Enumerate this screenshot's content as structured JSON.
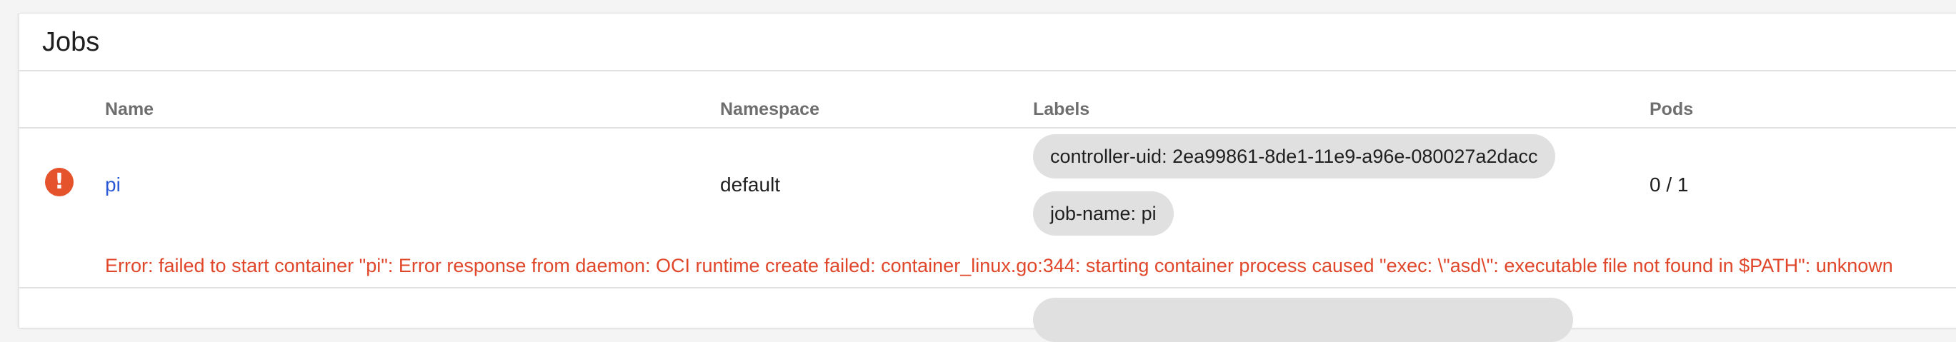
{
  "card": {
    "title": "Jobs"
  },
  "table": {
    "columns": {
      "name": "Name",
      "namespace": "Namespace",
      "labels": "Labels",
      "pods": "Pods"
    },
    "rows": [
      {
        "status": "error",
        "status_icon": "error-icon",
        "name": "pi",
        "namespace": "default",
        "labels": [
          "controller-uid: 2ea99861-8de1-11e9-a96e-080027a2dacc",
          "job-name: pi"
        ],
        "pods": "0 / 1",
        "error_message": "Error: failed to start container \"pi\": Error response from daemon: OCI runtime create failed: container_linux.go:344: starting container process caused \"exec: \\\"asd\\\": executable file not found in $PATH\": unknown"
      }
    ]
  },
  "colors": {
    "error": "#e5532d",
    "link": "#2b58d4",
    "chip_background": "#e0e0e0"
  }
}
